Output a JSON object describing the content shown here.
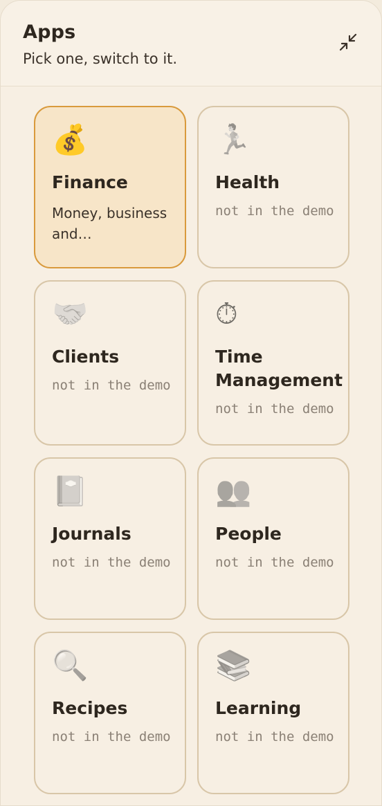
{
  "header": {
    "title": "Apps",
    "subtitle": "Pick one, switch to it."
  },
  "collapse_icon": "collapse-arrows-icon",
  "colors": {
    "accent": "#d99a3c",
    "active_bg": "#f7e5c8",
    "card_border": "#d8c6a8",
    "panel_bg": "#f7efe3"
  },
  "apps": [
    {
      "emoji": "💰",
      "name": "Finance",
      "desc": "Money, business and…",
      "active": true
    },
    {
      "emoji": "🏃",
      "name": "Health",
      "desc": "not in the demo",
      "active": false
    },
    {
      "emoji": "🤝",
      "name": "Clients",
      "desc": "not in the demo",
      "active": false
    },
    {
      "emoji": "⏱",
      "name": "Time Management",
      "desc": "not in the demo",
      "active": false
    },
    {
      "emoji": "📔",
      "name": "Journals",
      "desc": "not in the demo",
      "active": false
    },
    {
      "emoji": "👥",
      "name": "People",
      "desc": "not in the demo",
      "active": false
    },
    {
      "emoji": "🔍",
      "name": "Recipes",
      "desc": "not in the demo",
      "active": false
    },
    {
      "emoji": "📚",
      "name": "Learning",
      "desc": "not in the demo",
      "active": false
    }
  ]
}
